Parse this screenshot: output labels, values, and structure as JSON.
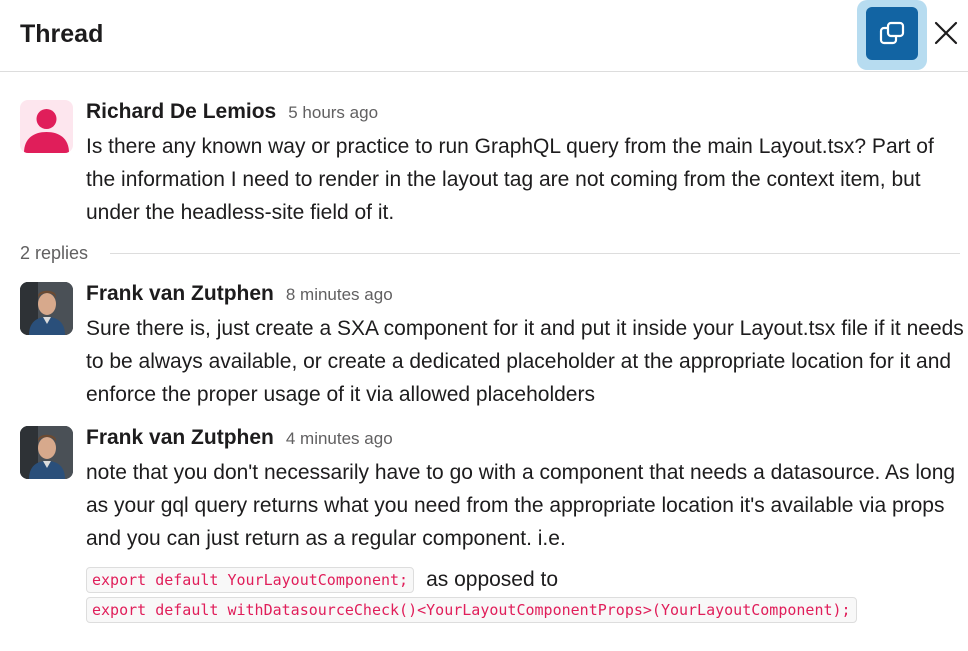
{
  "header": {
    "title": "Thread",
    "popout_icon": "popout-window-icon",
    "close_icon": "close-icon"
  },
  "parent": {
    "author": "Richard De Lemios",
    "time": "5 hours ago",
    "text": "Is there any known way or practice to run GraphQL query from the main Layout.tsx? Part of the information I need to render in the layout tag are not coming from the context item, but under the headless-site field of it.",
    "avatar": "default-user-avatar-icon"
  },
  "replies_label": "2 replies",
  "replies": [
    {
      "author": "Frank van Zutphen",
      "time": "8 minutes ago",
      "text": "Sure there is, just create a SXA component for it and put it inside your Layout.tsx file if it needs to be always available, or create a dedicated placeholder at the appropriate location for it and enforce the proper usage of it via allowed placeholders"
    },
    {
      "author": "Frank van Zutphen",
      "time": "4 minutes ago",
      "text": "note that you don't necessarily have to go with a component that needs a datasource. As long as your gql query returns what you need from the appropriate location it's available via props and you can just return as a regular component. i.e.",
      "code1": "export default YourLayoutComponent;",
      "between": "as opposed to",
      "code2": "export default withDatasourceCheck()<YourLayoutComponentProps>(YourLayoutComponent);"
    }
  ],
  "colors": {
    "accent": "#1264a3",
    "accent_ring": "#b7dcf0",
    "avatar_pink": "#e01e5a",
    "code_text": "#e01e5a"
  }
}
